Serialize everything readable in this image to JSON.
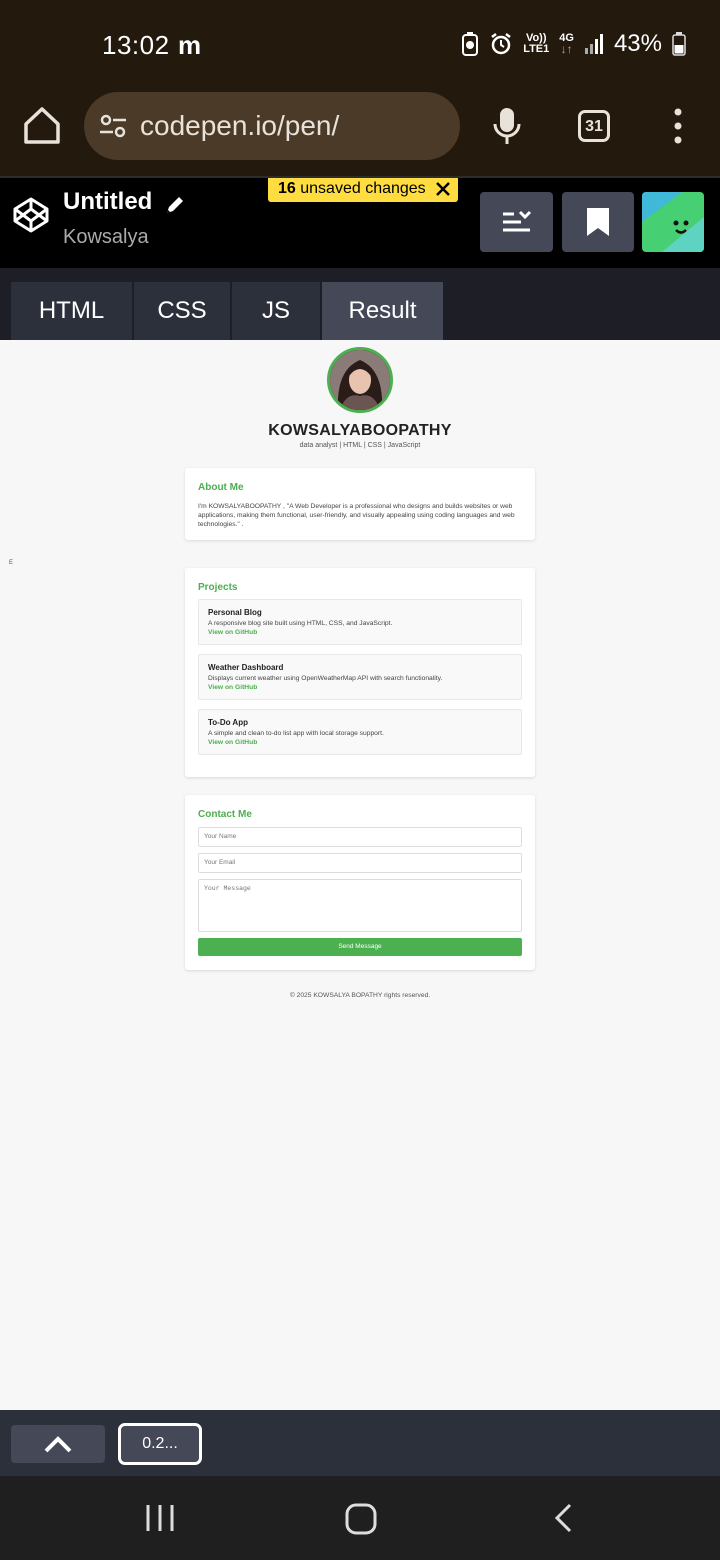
{
  "status_bar": {
    "time": "13:02",
    "notification": "m",
    "network_top": "Vo))",
    "network_bottom": "LTE1",
    "network_type": "4G",
    "battery": "43%"
  },
  "browser": {
    "url": "codepen.io/pen/",
    "tab_count": "31",
    "icons": [
      "home-icon",
      "site-settings-icon",
      "mic-icon",
      "tabs-icon",
      "menu-icon"
    ]
  },
  "codepen_header": {
    "title": "Untitled",
    "user": "Kowsalya",
    "unsaved_count": "16",
    "unsaved_text": "unsaved changes"
  },
  "editor_tabs": [
    {
      "label": "HTML",
      "active": false
    },
    {
      "label": "CSS",
      "active": false
    },
    {
      "label": "JS",
      "active": false
    },
    {
      "label": "Result",
      "active": true
    }
  ],
  "result": {
    "name": "KOWSALYABOOPATHY",
    "tagline": "data analyst | HTML | CSS | JavaScript",
    "stray_text": "E",
    "about": {
      "heading": "About Me",
      "text": "I'm KOWSALYABOOPATHY , \"A Web Developer is a professional who designs and builds websites or web applications, making them functional, user-friendly, and visually appealing using coding languages and web technologies.\" ."
    },
    "projects": {
      "heading": "Projects",
      "items": [
        {
          "title": "Personal Blog",
          "desc": "A responsive blog site built using HTML, CSS, and JavaScript.",
          "link": "View on GitHub"
        },
        {
          "title": "Weather Dashboard",
          "desc": "Displays current weather using OpenWeatherMap API with search functionality.",
          "link": "View on GitHub"
        },
        {
          "title": "To-Do App",
          "desc": "A simple and clean to-do list app with local storage support.",
          "link": "View on GitHub"
        }
      ]
    },
    "contact": {
      "heading": "Contact Me",
      "name_placeholder": "Your Name",
      "email_placeholder": "Your Email",
      "message_placeholder": "Your Message",
      "send_label": "Send Message"
    },
    "footer": "© 2025 KOWSALYA BOPATHY rights reserved.",
    "accent_color": "#4caf50"
  },
  "bottom_bar": {
    "version_label": "0.2..."
  }
}
